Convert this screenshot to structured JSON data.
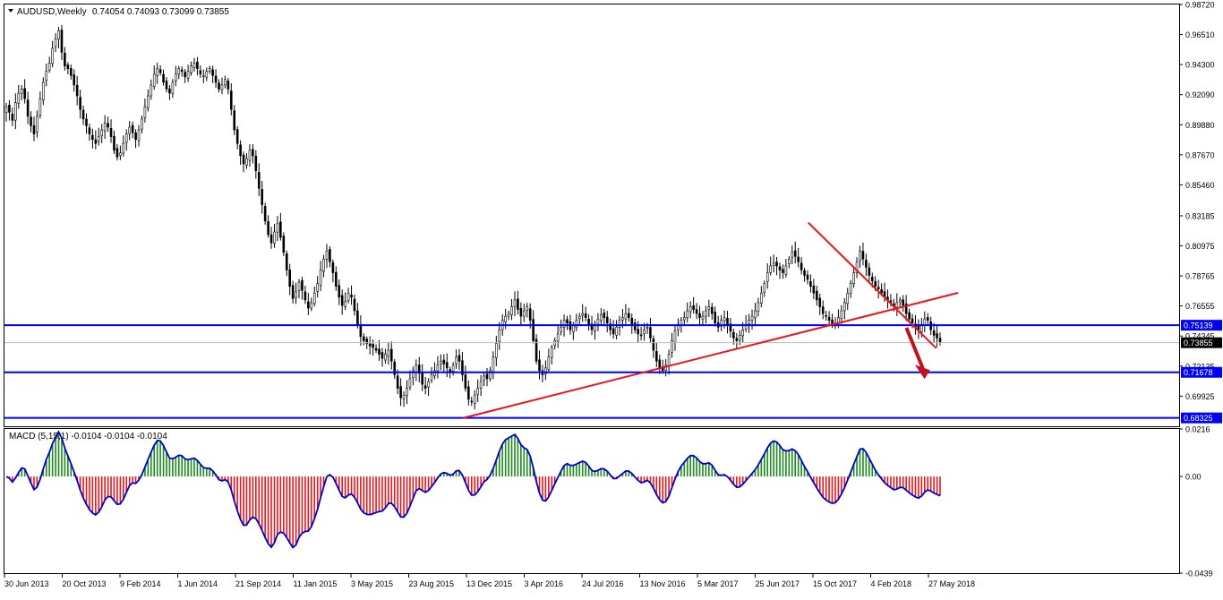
{
  "window": {
    "title": "AUDUSD,Weekly",
    "ohlc": "0.74054 0.74093 0.73099 0.73855",
    "menu_icon": "triangle-down-icon"
  },
  "colors": {
    "up_candle": "#000000",
    "down_candle": "#000000",
    "hline": "#0000ff",
    "trendline": "#e8161b",
    "arrow": "#c0121a",
    "macd_up": "#1a8a1a",
    "macd_down": "#e8161b",
    "macd_signal": "#0000cc",
    "price_tag_bg": "#0000ff",
    "current_tag_bg": "#000000"
  },
  "chart_data": [
    {
      "type": "candlestick",
      "symbol": "AUDUSD",
      "timeframe": "Weekly",
      "ylim": [
        0.6771,
        0.9872
      ],
      "y_ticks": [
        "0.98720",
        "0.96510",
        "0.94300",
        "0.92090",
        "0.89880",
        "0.87670",
        "0.85460",
        "0.83185",
        "0.80975",
        "0.78765",
        "0.76555",
        "0.74345",
        "0.72135",
        "0.69925"
      ],
      "x_ticks": [
        "30 Jun 2013",
        "20 Oct 2013",
        "9 Feb 2014",
        "1 Jun 2014",
        "21 Sep 2014",
        "11 Jan 2015",
        "3 May 2015",
        "23 Aug 2015",
        "13 Dec 2015",
        "3 Apr 2016",
        "24 Jul 2016",
        "13 Nov 2016",
        "5 Mar 2017",
        "25 Jun 2017",
        "15 Oct 2017",
        "4 Feb 2018",
        "27 May 2018"
      ],
      "closes": [
        0.912,
        0.908,
        0.902,
        0.915,
        0.922,
        0.925,
        0.918,
        0.905,
        0.898,
        0.892,
        0.905,
        0.918,
        0.93,
        0.938,
        0.944,
        0.955,
        0.962,
        0.968,
        0.952,
        0.942,
        0.94,
        0.935,
        0.928,
        0.92,
        0.91,
        0.903,
        0.898,
        0.892,
        0.888,
        0.885,
        0.89,
        0.895,
        0.9,
        0.897,
        0.89,
        0.88,
        0.875,
        0.878,
        0.885,
        0.892,
        0.897,
        0.893,
        0.888,
        0.895,
        0.903,
        0.912,
        0.92,
        0.928,
        0.936,
        0.94,
        0.937,
        0.93,
        0.925,
        0.922,
        0.93,
        0.936,
        0.94,
        0.938,
        0.934,
        0.938,
        0.942,
        0.944,
        0.94,
        0.936,
        0.935,
        0.938,
        0.94,
        0.935,
        0.93,
        0.925,
        0.928,
        0.932,
        0.925,
        0.91,
        0.895,
        0.885,
        0.876,
        0.87,
        0.874,
        0.88,
        0.876,
        0.865,
        0.852,
        0.84,
        0.828,
        0.818,
        0.812,
        0.82,
        0.826,
        0.816,
        0.805,
        0.792,
        0.78,
        0.771,
        0.776,
        0.783,
        0.777,
        0.77,
        0.764,
        0.768,
        0.775,
        0.782,
        0.792,
        0.8,
        0.806,
        0.798,
        0.79,
        0.78,
        0.772,
        0.766,
        0.769,
        0.775,
        0.772,
        0.762,
        0.752,
        0.743,
        0.74,
        0.738,
        0.736,
        0.735,
        0.733,
        0.73,
        0.727,
        0.73,
        0.733,
        0.725,
        0.715,
        0.705,
        0.698,
        0.7,
        0.705,
        0.712,
        0.718,
        0.722,
        0.716,
        0.708,
        0.705,
        0.71,
        0.715,
        0.718,
        0.722,
        0.725,
        0.723,
        0.72,
        0.717,
        0.722,
        0.728,
        0.725,
        0.715,
        0.705,
        0.697,
        0.695,
        0.7,
        0.705,
        0.71,
        0.714,
        0.712,
        0.718,
        0.728,
        0.738,
        0.748,
        0.755,
        0.758,
        0.76,
        0.765,
        0.77,
        0.763,
        0.758,
        0.762,
        0.765,
        0.755,
        0.74,
        0.725,
        0.718,
        0.715,
        0.72,
        0.728,
        0.735,
        0.74,
        0.745,
        0.75,
        0.755,
        0.753,
        0.748,
        0.751,
        0.755,
        0.758,
        0.76,
        0.757,
        0.752,
        0.748,
        0.752,
        0.756,
        0.759,
        0.757,
        0.753,
        0.748,
        0.745,
        0.75,
        0.755,
        0.757,
        0.76,
        0.757,
        0.752,
        0.748,
        0.745,
        0.744,
        0.748,
        0.75,
        0.742,
        0.733,
        0.725,
        0.72,
        0.718,
        0.722,
        0.73,
        0.74,
        0.747,
        0.752,
        0.755,
        0.757,
        0.762,
        0.765,
        0.763,
        0.76,
        0.757,
        0.758,
        0.762,
        0.765,
        0.76,
        0.753,
        0.75,
        0.755,
        0.757,
        0.752,
        0.747,
        0.742,
        0.74,
        0.744,
        0.748,
        0.752,
        0.755,
        0.758,
        0.762,
        0.768,
        0.775,
        0.782,
        0.79,
        0.795,
        0.797,
        0.795,
        0.792,
        0.79,
        0.795,
        0.8,
        0.805,
        0.802,
        0.798,
        0.792,
        0.788,
        0.785,
        0.78,
        0.775,
        0.77,
        0.765,
        0.76,
        0.758,
        0.755,
        0.752,
        0.753,
        0.757,
        0.762,
        0.768,
        0.775,
        0.782,
        0.79,
        0.798,
        0.806,
        0.8,
        0.794,
        0.788,
        0.784,
        0.78,
        0.778,
        0.775,
        0.772,
        0.77,
        0.768,
        0.765,
        0.768,
        0.77,
        0.766,
        0.76,
        0.756,
        0.753,
        0.75,
        0.748,
        0.752,
        0.756,
        0.755,
        0.748,
        0.744,
        0.742,
        0.739
      ],
      "hlines": [
        0.75139,
        0.71678,
        0.68325
      ],
      "hline_labels": [
        "0.75139",
        "0.71678",
        "0.68325"
      ],
      "current_price": 0.73855,
      "current_price_label": "0.73855",
      "trendlines": [
        {
          "from": [
            0.3905,
            0.6832
          ],
          "to": [
            0.8119,
            0.7752
          ]
        },
        {
          "from": [
            0.6843,
            0.8268
          ],
          "to": [
            0.7932,
            0.7345
          ]
        }
      ],
      "arrow": {
        "from": [
          0.7678,
          0.7495
        ],
        "to": [
          0.7818,
          0.7145
        ]
      }
    },
    {
      "type": "bar",
      "title": "MACD (5,15,1) -0.0104 -0.0104 -0.0104",
      "ylim": [
        -0.0439,
        0.0216
      ],
      "y_ticks": [
        "0.0216",
        "0.00",
        "-0.0439"
      ],
      "series": [
        {
          "name": "MACD",
          "values": []
        },
        {
          "name": "Signal",
          "values": []
        }
      ]
    }
  ]
}
